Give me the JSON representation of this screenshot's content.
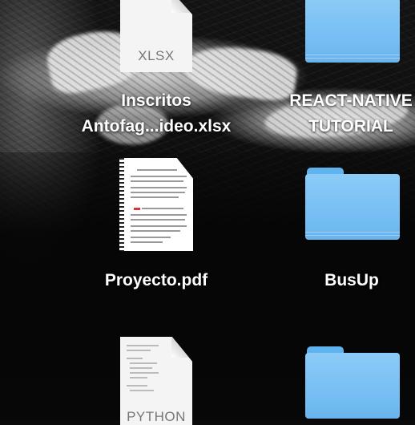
{
  "desktop": {
    "items": [
      {
        "name": "Inscritos\nAntofag...ideo.xlsx",
        "line1": "Inscritos",
        "line2": "Antofag...ideo.xlsx",
        "icon": "xlsx-document-icon",
        "ext": "XLSX"
      },
      {
        "name": "REACT-NATIVE TUTORIAL",
        "line1": "REACT-NATIVE",
        "line2": "TUTORIAL",
        "icon": "folder-icon"
      },
      {
        "name": "Proyecto.pdf",
        "line1": "Proyecto.pdf",
        "icon": "pdf-thumbnail-icon"
      },
      {
        "name": "BusUp",
        "line1": "BusUp",
        "icon": "folder-icon"
      },
      {
        "name": "python document",
        "icon": "python-document-icon",
        "ext": "PYTHON"
      },
      {
        "name": "folder",
        "icon": "folder-icon"
      }
    ]
  },
  "colors": {
    "folder": "#7fc3f5",
    "folder_tab": "#5fb3ef",
    "label_text": "#ffffff"
  }
}
